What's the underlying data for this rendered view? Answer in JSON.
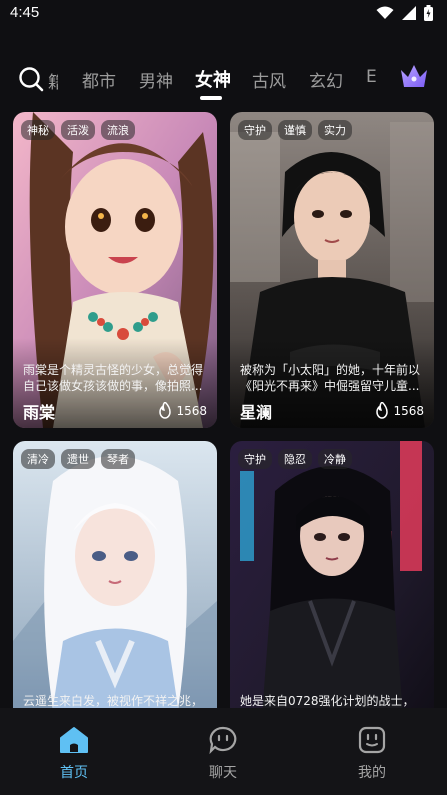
{
  "status": {
    "time": "4:45"
  },
  "tabs": {
    "partial_left": "籍",
    "items": [
      "都市",
      "男神",
      "女神",
      "古风",
      "玄幻"
    ],
    "partial_right": "E",
    "active": "女神"
  },
  "cards": [
    {
      "tags": [
        "神秘",
        "活泼",
        "流浪"
      ],
      "desc": "雨棠是个精灵古怪的少女，总觉得自己该做女孩该做的事，像拍照...",
      "name": "雨棠",
      "heat": "1568"
    },
    {
      "tags": [
        "守护",
        "谨慎",
        "实力"
      ],
      "desc": "被称为「小太阳」的她，十年前以《阳光不再来》中倔强留守儿童...",
      "name": "星澜",
      "heat": "1568"
    },
    {
      "tags": [
        "清冷",
        "遗世",
        "琴者"
      ],
      "desc": "云遥生来白发，被视作不祥之兆，",
      "name": "",
      "heat": ""
    },
    {
      "tags": [
        "守护",
        "隐忍",
        "冷静"
      ],
      "desc": "她是来自0728强化计划的战士，",
      "name": "",
      "heat": ""
    }
  ],
  "nav": {
    "home": "首页",
    "chat": "聊天",
    "mine": "我的",
    "active_color": "#5fc0f3"
  }
}
